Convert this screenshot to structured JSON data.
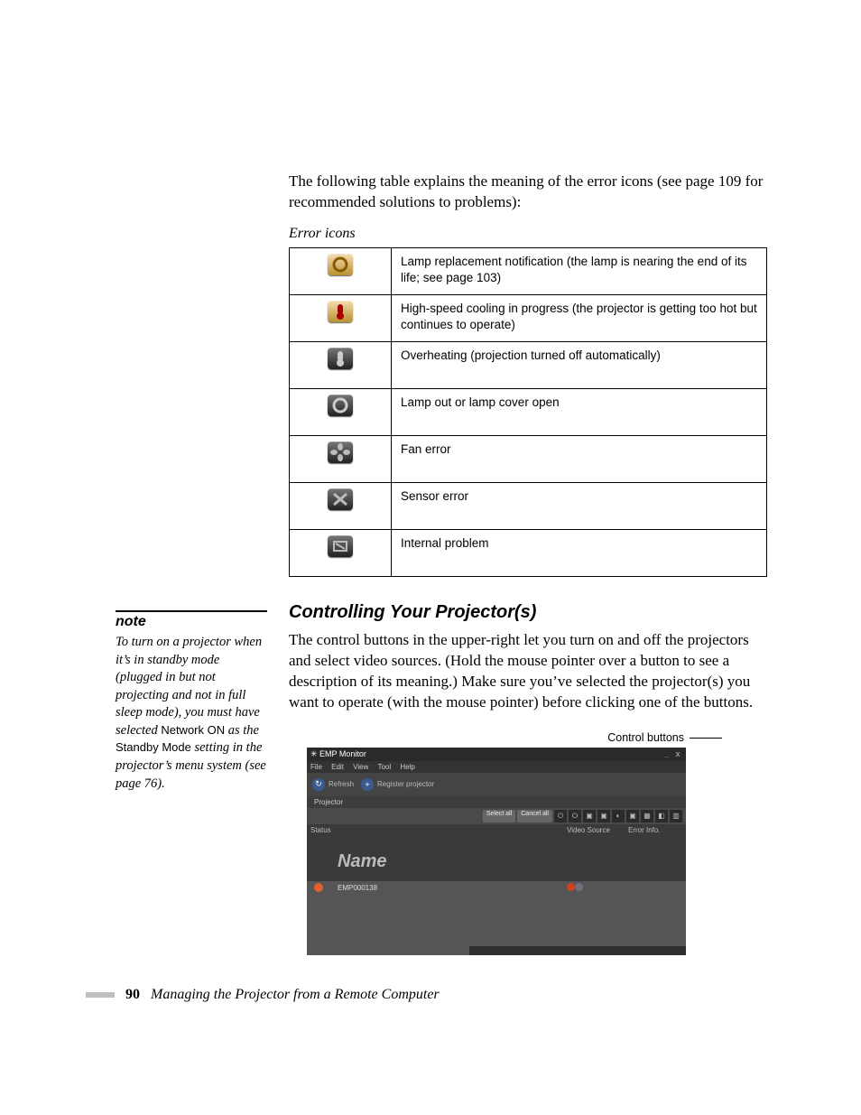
{
  "intro": "The following table explains the meaning of the error icons (see page 109 for recommended solutions to problems):",
  "table_caption": "Error icons",
  "error_rows": [
    {
      "icon": "lamp-warn-icon",
      "desc": "Lamp replacement notification (the lamp is nearing the end of its life; see page 103)"
    },
    {
      "icon": "temp-warn-icon",
      "desc": "High-speed cooling in progress (the projector is getting too hot but continues to operate)"
    },
    {
      "icon": "overheat-icon",
      "desc": "Overheating (projection turned off automatically)"
    },
    {
      "icon": "lamp-out-icon",
      "desc": "Lamp out or lamp cover open"
    },
    {
      "icon": "fan-error-icon",
      "desc": "Fan error"
    },
    {
      "icon": "sensor-error-icon",
      "desc": "Sensor error"
    },
    {
      "icon": "internal-error-icon",
      "desc": "Internal problem"
    }
  ],
  "section_heading": "Controlling Your Projector(s)",
  "section_body": "The control buttons in the upper-right let you turn on and off the projectors and select video sources. (Hold the mouse pointer over a button to see a description of its meaning.) Make sure you’ve selected the projector(s) you want to operate (with the mouse pointer) before clicking one of the buttons.",
  "note": {
    "head": "note",
    "body_pre": "To turn on a projector when it’s in standby mode (plugged in but not projecting and not in full sleep mode), you must have selected ",
    "network_on": "Network ON",
    "body_mid": " as the ",
    "standby_mode": "Standby Mode",
    "body_post": " setting in the projector’s menu system (see page 76)."
  },
  "callout": "Control buttons",
  "screenshot": {
    "title_prefix": "EMP Monitor",
    "menu": [
      "File",
      "Edit",
      "View",
      "Tool",
      "Help"
    ],
    "tab_refresh": "Refresh",
    "tab_register": "Register projector",
    "group_tab": "Projector",
    "btn_select_all": "Select all",
    "btn_cancel_all": "Cancel all",
    "col_status": "Status",
    "col_name": "Name",
    "col_video": "Video Source",
    "col_error": "Error Info.",
    "row_name": "EMP000138",
    "win_min": "_",
    "win_close": "x"
  },
  "footer": {
    "page": "90",
    "title": "Managing the Projector from a Remote Computer"
  }
}
